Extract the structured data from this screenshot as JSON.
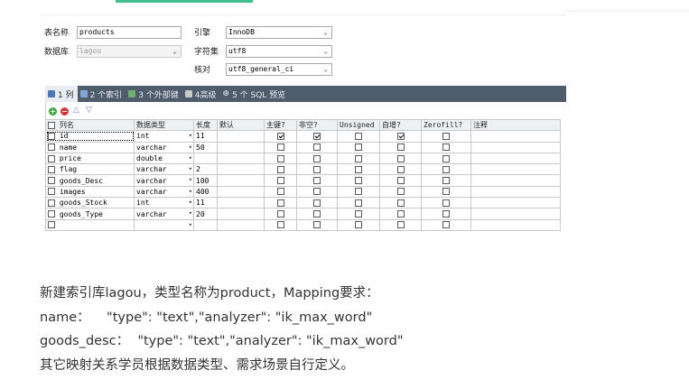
{
  "form": {
    "table_name_label": "表名称",
    "table_name_value": "products",
    "database_label": "数据库",
    "database_value": "lagou",
    "engine_label": "引擎",
    "engine_value": "InnoDB",
    "charset_label": "字符集",
    "charset_value": "utf8",
    "collation_label": "核对",
    "collation_value": "utf8_general_ci"
  },
  "tabs": [
    {
      "label": "1 列"
    },
    {
      "label": "2 个索引"
    },
    {
      "label": "3 个外部键"
    },
    {
      "label": "4高级"
    },
    {
      "label": "5 个 SQL 预览"
    }
  ],
  "columns_header": [
    "列名",
    "数据类型",
    "长度",
    "默认",
    "主键?",
    "非空?",
    "Unsigned",
    "自增?",
    "Zerofill?",
    "注释"
  ],
  "rows": [
    {
      "name": "id",
      "type": "int",
      "length": "11",
      "pk": true,
      "notnull": true,
      "unsigned": false,
      "autoinc": true,
      "zerofill": false
    },
    {
      "name": "name",
      "type": "varchar",
      "length": "50",
      "pk": false,
      "notnull": false,
      "unsigned": false,
      "autoinc": false,
      "zerofill": false
    },
    {
      "name": "price",
      "type": "double",
      "length": "",
      "pk": false,
      "notnull": false,
      "unsigned": false,
      "autoinc": false,
      "zerofill": false
    },
    {
      "name": "flag",
      "type": "varchar",
      "length": "2",
      "pk": false,
      "notnull": false,
      "unsigned": false,
      "autoinc": false,
      "zerofill": false
    },
    {
      "name": "goods_Desc",
      "type": "varchar",
      "length": "100",
      "pk": false,
      "notnull": false,
      "unsigned": false,
      "autoinc": false,
      "zerofill": false
    },
    {
      "name": "images",
      "type": "varchar",
      "length": "400",
      "pk": false,
      "notnull": false,
      "unsigned": false,
      "autoinc": false,
      "zerofill": false
    },
    {
      "name": "goods_Stock",
      "type": "int",
      "length": "11",
      "pk": false,
      "notnull": false,
      "unsigned": false,
      "autoinc": false,
      "zerofill": false
    },
    {
      "name": "goods_Type",
      "type": "varchar",
      "length": "20",
      "pk": false,
      "notnull": false,
      "unsigned": false,
      "autoinc": false,
      "zerofill": false
    },
    {
      "name": "",
      "type": "",
      "length": "",
      "pk": false,
      "notnull": false,
      "unsigned": false,
      "autoinc": false,
      "zerofill": false
    }
  ],
  "text": {
    "line1": "新建索引库lagou，类型名称为product，Mapping要求：",
    "line2": "name：    \"type\": \"text\",\"analyzer\": \"ik_max_word\"",
    "line3": "goods_desc：  \"type\": \"text\",\"analyzer\": \"ik_max_word\"",
    "line4": "其它映射关系学员根据数据类型、需求场景自行定义。"
  }
}
